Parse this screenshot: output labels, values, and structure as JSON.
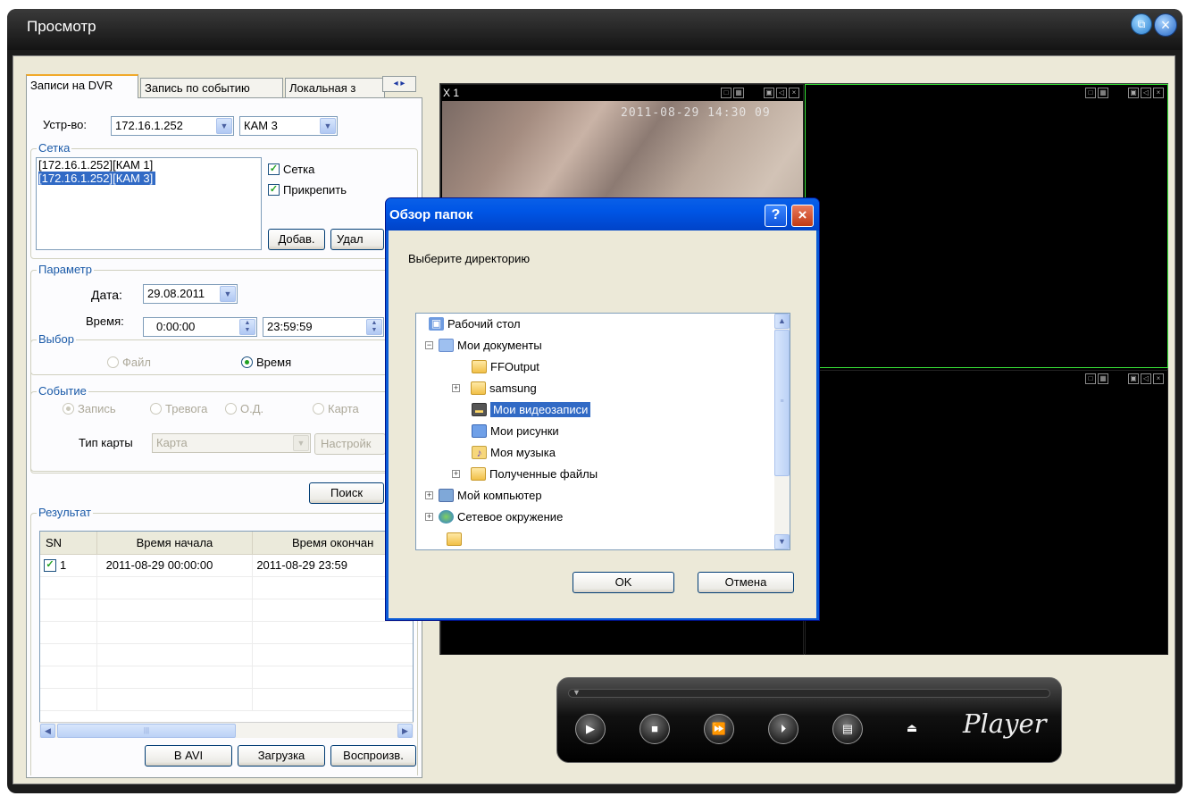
{
  "window": {
    "title": "Просмотр"
  },
  "tabs": [
    "Записи на DVR",
    "Запись по событию",
    "Локальная з"
  ],
  "tab_arrows": "◂ ▸",
  "device": {
    "label": "Устр-во:",
    "ip": "172.16.1.252",
    "camera": "КАМ 3"
  },
  "grid_group": {
    "title": "Сетка",
    "items": [
      "[172.16.1.252][КАМ 1]",
      "[172.16.1.252][КАМ 3]"
    ],
    "check_grid": "Сетка",
    "check_pin": "Прикрепить",
    "add_button": "Добав.",
    "delete_button": "Удал"
  },
  "params": {
    "title": "Параметр",
    "date_label": "Дата:",
    "date": "29.08.2011",
    "time_label": "Время:",
    "time_from": "0:00:00",
    "time_to": "23:59:59"
  },
  "choice": {
    "title": "Выбор",
    "file": "Файл",
    "time": "Время"
  },
  "event": {
    "title": "Событие",
    "record": "Запись",
    "alarm": "Тревога",
    "od": "О.Д.",
    "card": "Карта",
    "card_type_label": "Тип карты",
    "card_type_value": "Карта",
    "settings_button": "Настройк"
  },
  "search_button": "Поиск",
  "results": {
    "title": "Результат",
    "columns": [
      "SN",
      "Время начала",
      "Время окончан"
    ],
    "rows": [
      {
        "sn": "1",
        "start": "2011-08-29 00:00:00",
        "end": "2011-08-29 23:59"
      }
    ],
    "scroll_grip": "|||"
  },
  "bottom_buttons": {
    "avi": "В AVI",
    "download": "Загрузка",
    "play": "Воспроизв."
  },
  "video": {
    "cell1_title": "X 1",
    "timestamp": "2011-08-29 14:30 09"
  },
  "player": {
    "logo": "Player"
  },
  "dialog": {
    "title": "Обзор папок",
    "prompt": "Выберите директорию",
    "tree": [
      {
        "label": "Рабочий стол"
      },
      {
        "label": "Мои документы"
      },
      {
        "label": "FFOutput"
      },
      {
        "label": "samsung"
      },
      {
        "label": "Мои видеозаписи"
      },
      {
        "label": "Мои рисунки"
      },
      {
        "label": "Моя музыка"
      },
      {
        "label": "Полученные файлы"
      },
      {
        "label": "Мой компьютер"
      },
      {
        "label": "Сетевое окружение"
      }
    ],
    "ok": "OK",
    "cancel": "Отмена"
  }
}
